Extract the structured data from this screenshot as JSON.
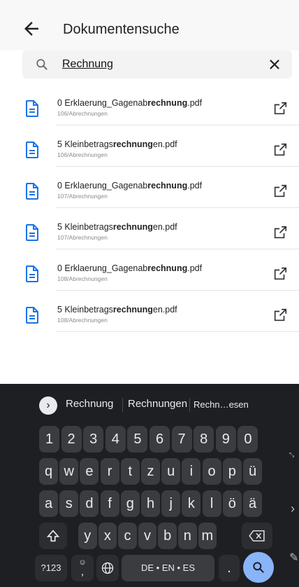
{
  "header": {
    "title": "Dokumentensuche"
  },
  "search": {
    "value": "Rechnung",
    "placeholder": ""
  },
  "results": [
    {
      "prefix": "0 Erklaerung_Gagenab",
      "match": "rechnung",
      "suffix": ".pdf",
      "path": "106/Abrechnungen"
    },
    {
      "prefix": "5 Kleinbetrags",
      "match": "rechnung",
      "suffix": "en.pdf",
      "path": "106/Abrechnungen"
    },
    {
      "prefix": "0 Erklaerung_Gagenab",
      "match": "rechnung",
      "suffix": ".pdf",
      "path": "107/Abrechnungen"
    },
    {
      "prefix": "5 Kleinbetrags",
      "match": "rechnung",
      "suffix": "en.pdf",
      "path": "107/Abrechnungen"
    },
    {
      "prefix": "0 Erklaerung_Gagenab",
      "match": "rechnung",
      "suffix": ".pdf",
      "path": "108/Abrechnungen"
    },
    {
      "prefix": "5 Kleinbetrags",
      "match": "rechnung",
      "suffix": "en.pdf",
      "path": "108/Abrechnungen"
    }
  ],
  "keyboard": {
    "suggestions": [
      "Rechnung",
      "Rechnungen",
      "Rechn…esen"
    ],
    "rows": [
      [
        "1",
        "2",
        "3",
        "4",
        "5",
        "6",
        "7",
        "8",
        "9",
        "0"
      ],
      [
        "q",
        "w",
        "e",
        "r",
        "t",
        "z",
        "u",
        "i",
        "o",
        "p",
        "ü"
      ],
      [
        "a",
        "s",
        "d",
        "f",
        "g",
        "h",
        "j",
        "k",
        "l",
        "ö",
        "ä"
      ],
      [
        "y",
        "x",
        "c",
        "v",
        "b",
        "n",
        "m"
      ]
    ],
    "symbols_label": "?123",
    "emoji_label": "☺",
    "comma_label": ",",
    "space_label": "DE • EN • ES",
    "period_label": "."
  },
  "icons": {
    "back": "arrow-back-icon",
    "search": "search-icon",
    "clear": "close-icon",
    "document": "document-icon",
    "open": "open-external-icon",
    "shift": "shift-icon",
    "backspace": "backspace-icon",
    "globe": "globe-icon",
    "enter": "search-icon"
  },
  "colors": {
    "accent": "#1a73e8",
    "keyboard_bg": "#1e1f22",
    "key_bg": "#3b3c3f",
    "enter_key": "#8ab4f8"
  }
}
